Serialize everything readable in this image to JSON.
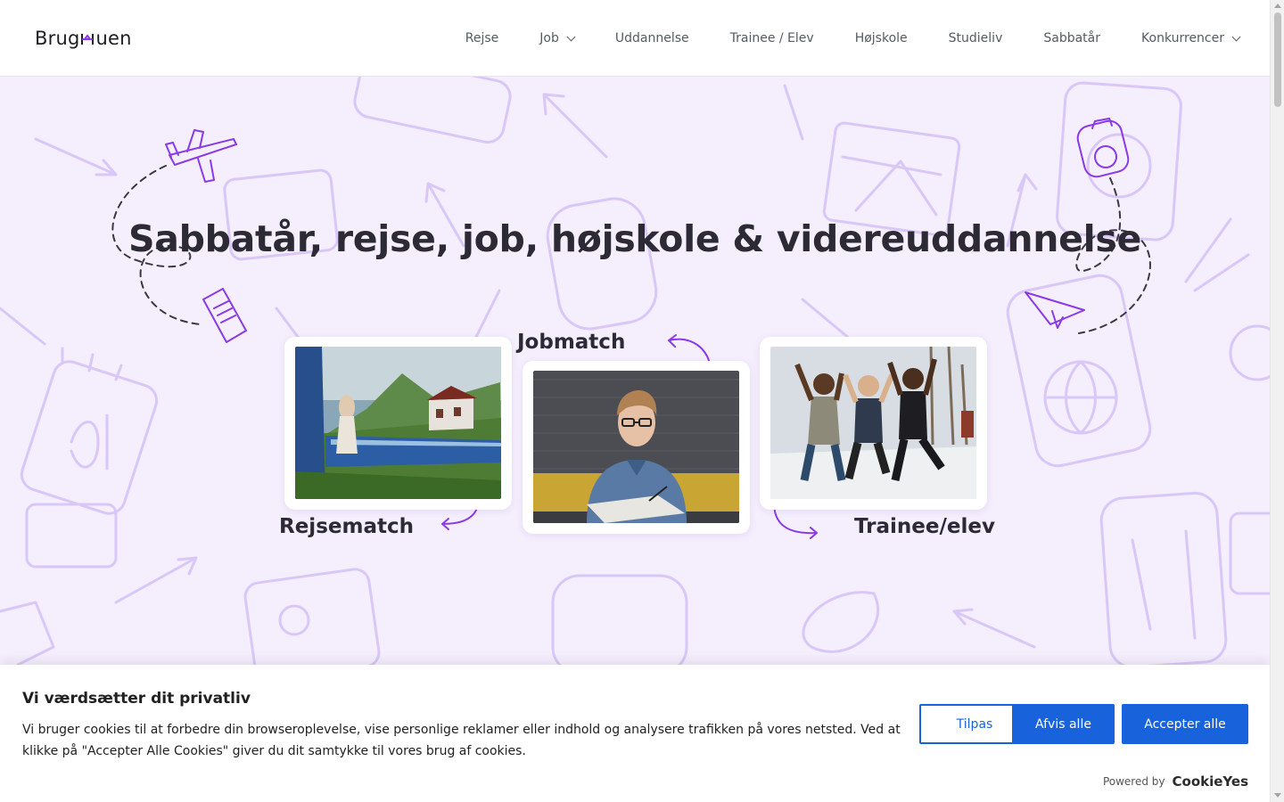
{
  "brand": {
    "logo_left": "Brug",
    "logo_right": "uen",
    "accent_color": "#8a3ae6"
  },
  "nav": {
    "items": [
      {
        "label": "Rejse",
        "has_dropdown": false
      },
      {
        "label": "Job",
        "has_dropdown": true
      },
      {
        "label": "Uddannelse",
        "has_dropdown": false
      },
      {
        "label": "Trainee / Elev",
        "has_dropdown": false
      },
      {
        "label": "Højskole",
        "has_dropdown": false
      },
      {
        "label": "Studieliv",
        "has_dropdown": false
      },
      {
        "label": "Sabbatår",
        "has_dropdown": false
      },
      {
        "label": "Konkurrencer",
        "has_dropdown": true
      }
    ]
  },
  "hero": {
    "title": "Sabbatår, rejse, job, højskole & videreuddannelse",
    "background_color": "#f4eefd",
    "cards": [
      {
        "label": "Rejsematch",
        "photo": "train-travel-photo"
      },
      {
        "label": "Jobmatch",
        "photo": "man-writing-photo"
      },
      {
        "label": "Trainee/elev",
        "photo": "friends-jumping-photo"
      }
    ]
  },
  "cookie": {
    "title": "Vi værdsætter dit privatliv",
    "text": "Vi bruger cookies til at forbedre din browseroplevelse, vise personlige reklamer eller indhold og analysere trafikken på vores netsted. Ved at klikke på \"Accepter Alle Cookies\" giver du dit samtykke til vores brug af cookies.",
    "buttons": {
      "customize": "Tilpas",
      "reject": "Afvis alle",
      "accept": "Accepter alle"
    },
    "button_color": "#1863dc",
    "powered_by": "Powered by",
    "powered_brand": "CookieYes"
  }
}
